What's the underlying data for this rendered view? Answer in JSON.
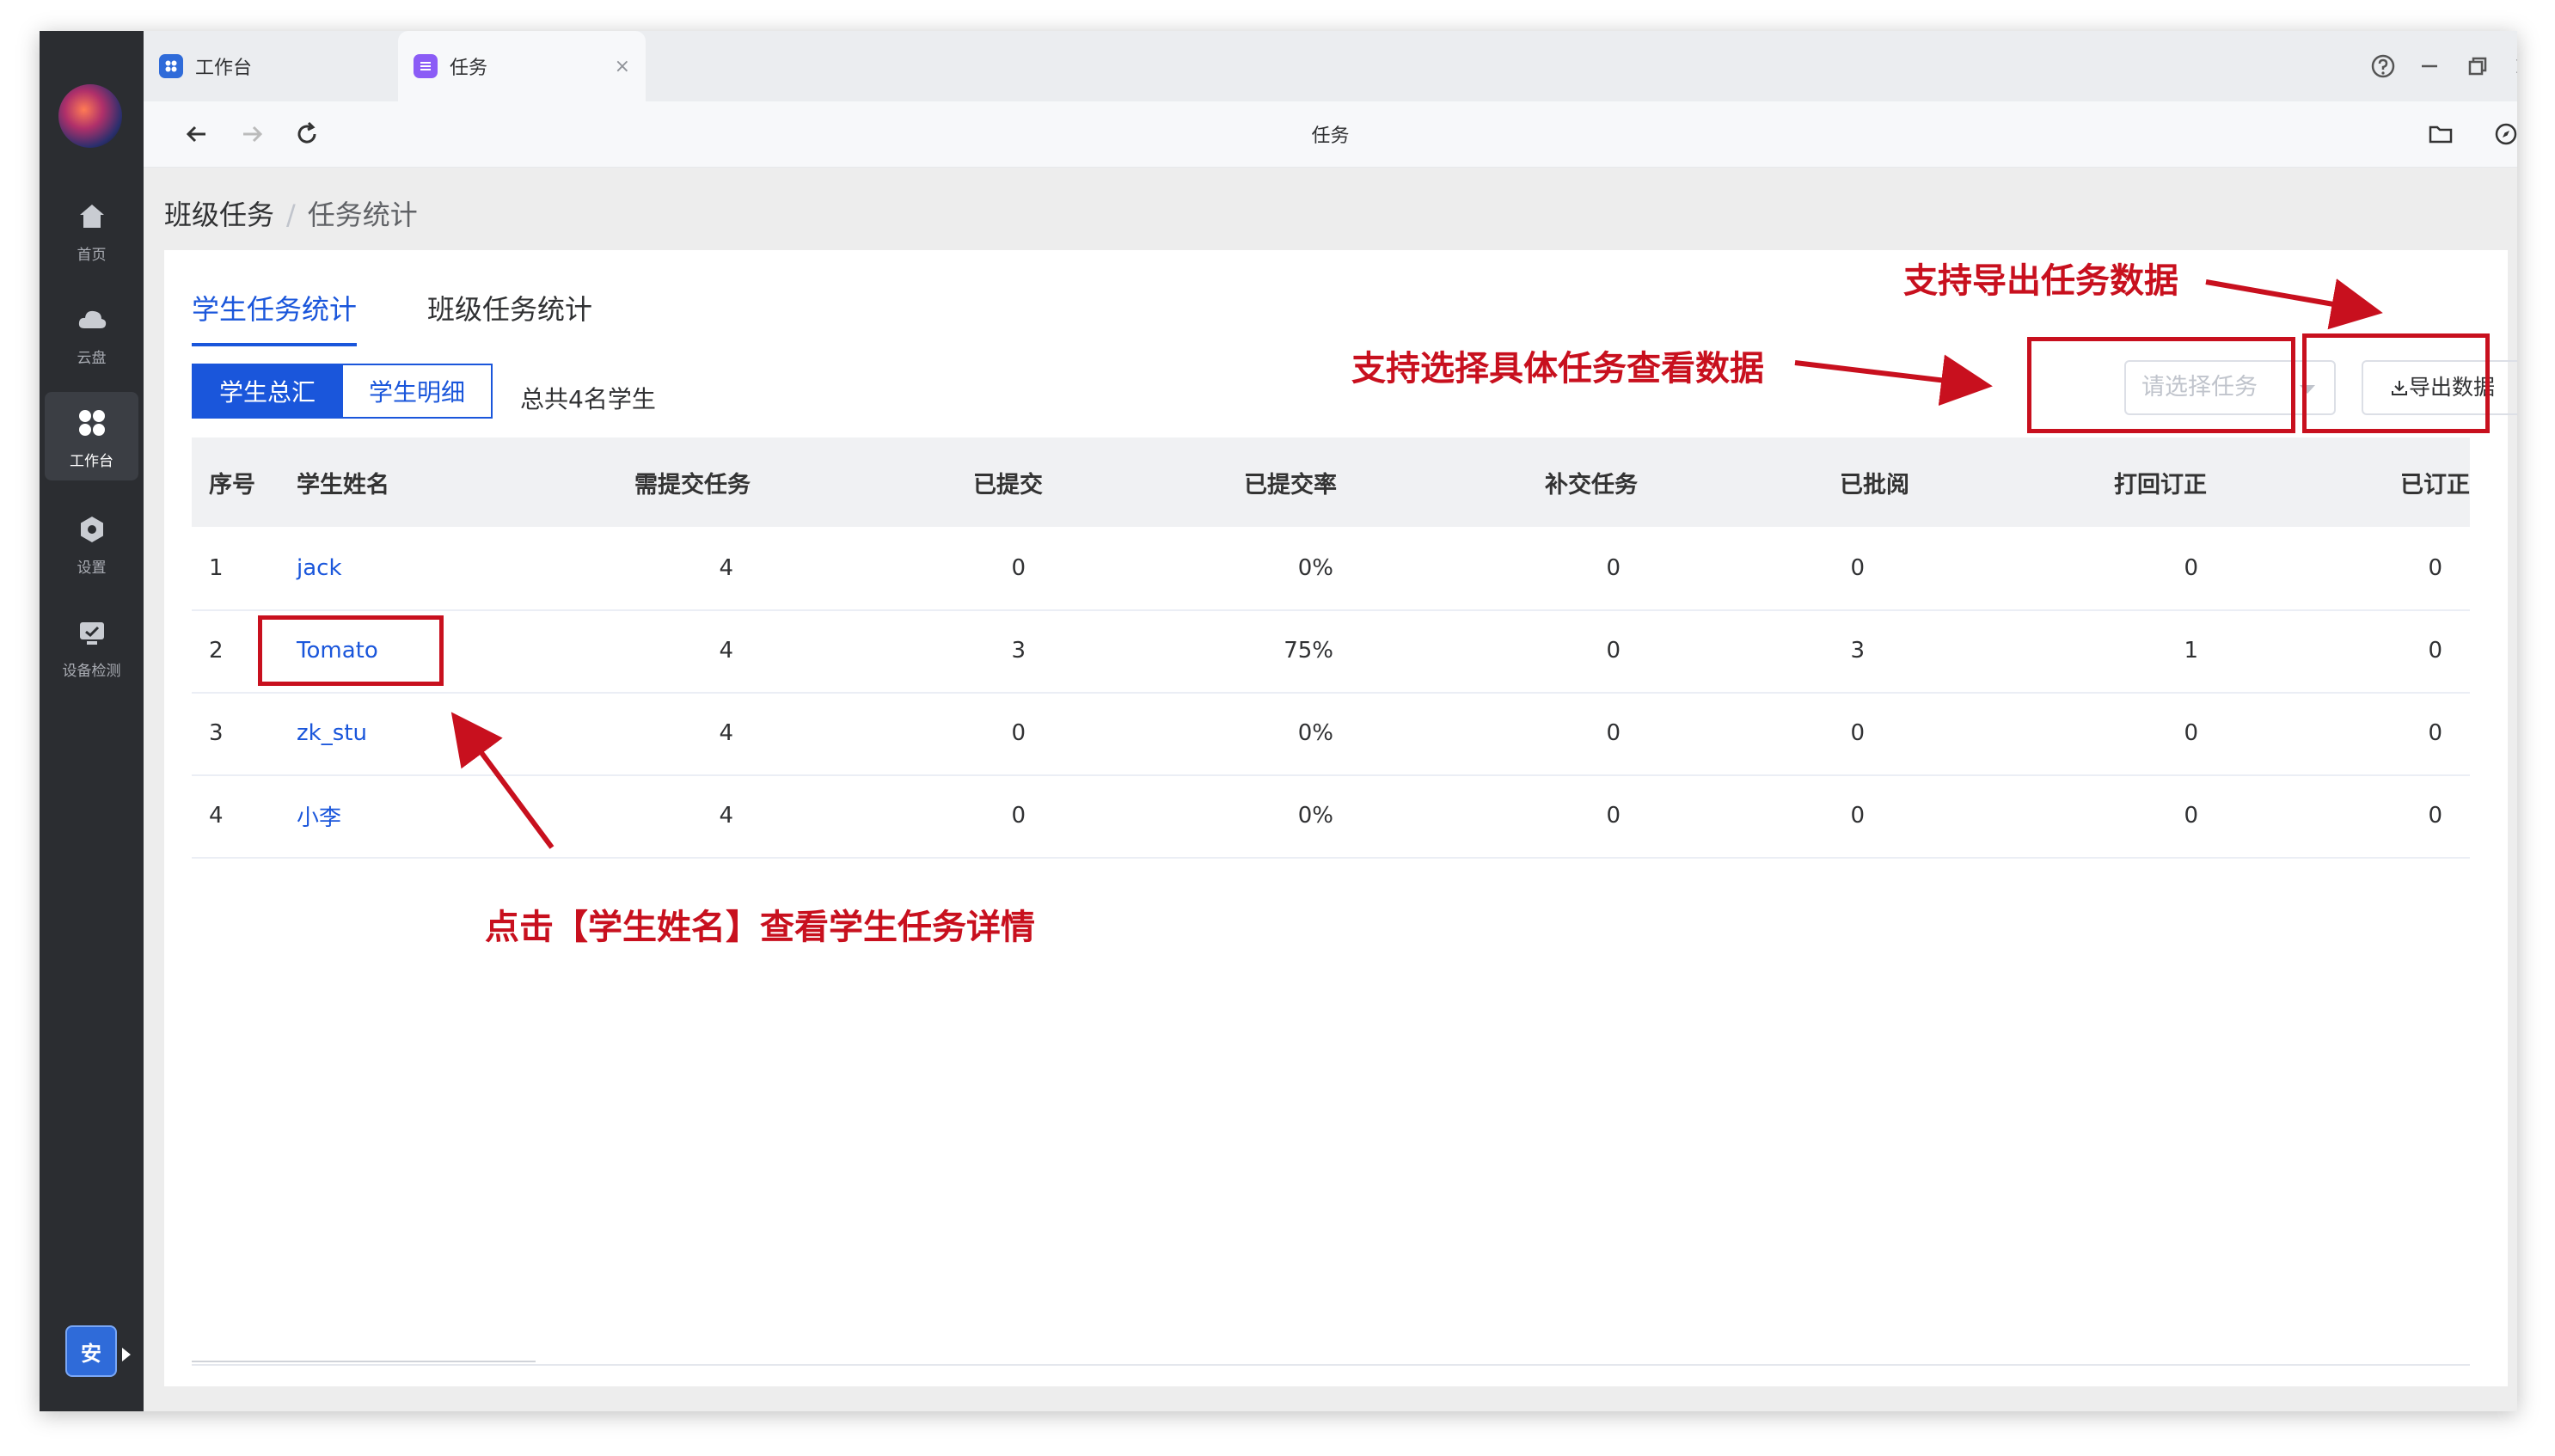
{
  "tabs": [
    {
      "label": "工作台"
    },
    {
      "label": "任务"
    }
  ],
  "nav": {
    "title": "任务"
  },
  "rail": {
    "items": [
      {
        "label": "首页",
        "icon": "home-icon"
      },
      {
        "label": "云盘",
        "icon": "cloud-icon"
      },
      {
        "label": "工作台",
        "icon": "grid-icon"
      },
      {
        "label": "设置",
        "icon": "settings-icon"
      },
      {
        "label": "设备检测",
        "icon": "device-check-icon"
      }
    ],
    "badge": "安"
  },
  "breadcrumb": {
    "parent": "班级任务",
    "separator": "/",
    "current": "任务统计"
  },
  "page_tabs": [
    {
      "label": "学生任务统计",
      "active": true
    },
    {
      "label": "班级任务统计",
      "active": false
    }
  ],
  "segment": {
    "on": "学生总汇",
    "off": "学生明细"
  },
  "total_text": "总共4名学生",
  "select": {
    "placeholder": "请选择任务"
  },
  "export_button": "导出数据",
  "table": {
    "headers": [
      "序号",
      "学生姓名",
      "需提交任务",
      "已提交",
      "已提交率",
      "补交任务",
      "已批阅",
      "打回订正",
      "已订正"
    ],
    "rows": [
      [
        "1",
        "jack",
        "4",
        "0",
        "0%",
        "0",
        "0",
        "0",
        "0"
      ],
      [
        "2",
        "Tomato",
        "4",
        "3",
        "75%",
        "0",
        "3",
        "1",
        "0"
      ],
      [
        "3",
        "zk_stu",
        "4",
        "0",
        "0%",
        "0",
        "0",
        "0",
        "0"
      ],
      [
        "4",
        "小李",
        "4",
        "0",
        "0%",
        "0",
        "0",
        "0",
        "0"
      ]
    ]
  },
  "annotations": {
    "export": "支持导出任务数据",
    "select": "支持选择具体任务查看数据",
    "click": "点击【学生姓名】查看学生任务详情"
  },
  "colors": {
    "accent": "#1a56db",
    "annotation": "#c8101e",
    "rail": "#2b2d31"
  }
}
